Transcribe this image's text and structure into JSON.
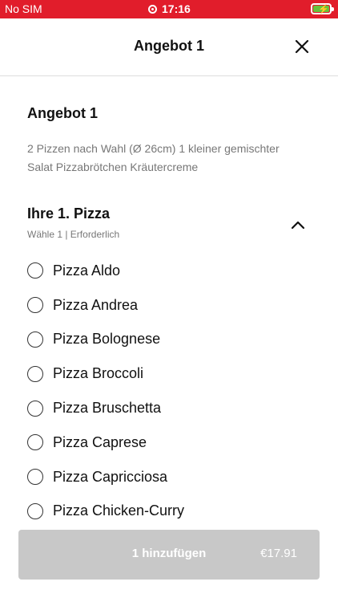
{
  "status_bar": {
    "carrier": "No SIM",
    "time": "17:16"
  },
  "header": {
    "title": "Angebot 1",
    "close_icon": "close-icon"
  },
  "offer": {
    "title": "Angebot 1",
    "description": "2 Pizzen nach Wahl (Ø 26cm) 1 kleiner gemischter Salat Pizzabrötchen Kräutercreme"
  },
  "section": {
    "title": "Ihre 1. Pizza",
    "subtitle": "Wähle 1  |  Erforderlich",
    "chevron_icon": "chevron-up-icon"
  },
  "options": [
    {
      "label": "Pizza Aldo"
    },
    {
      "label": "Pizza Andrea"
    },
    {
      "label": "Pizza Bolognese"
    },
    {
      "label": "Pizza Broccoli"
    },
    {
      "label": "Pizza Bruschetta"
    },
    {
      "label": "Pizza Caprese"
    },
    {
      "label": "Pizza Capricciosa"
    },
    {
      "label": "Pizza Chicken-Curry"
    }
  ],
  "footer": {
    "add_label": "1 hinzufügen",
    "price": "€17.91"
  },
  "colors": {
    "status_bar": "#e11d2b",
    "button_disabled": "#c8c8c8",
    "battery": "#67c23a"
  }
}
